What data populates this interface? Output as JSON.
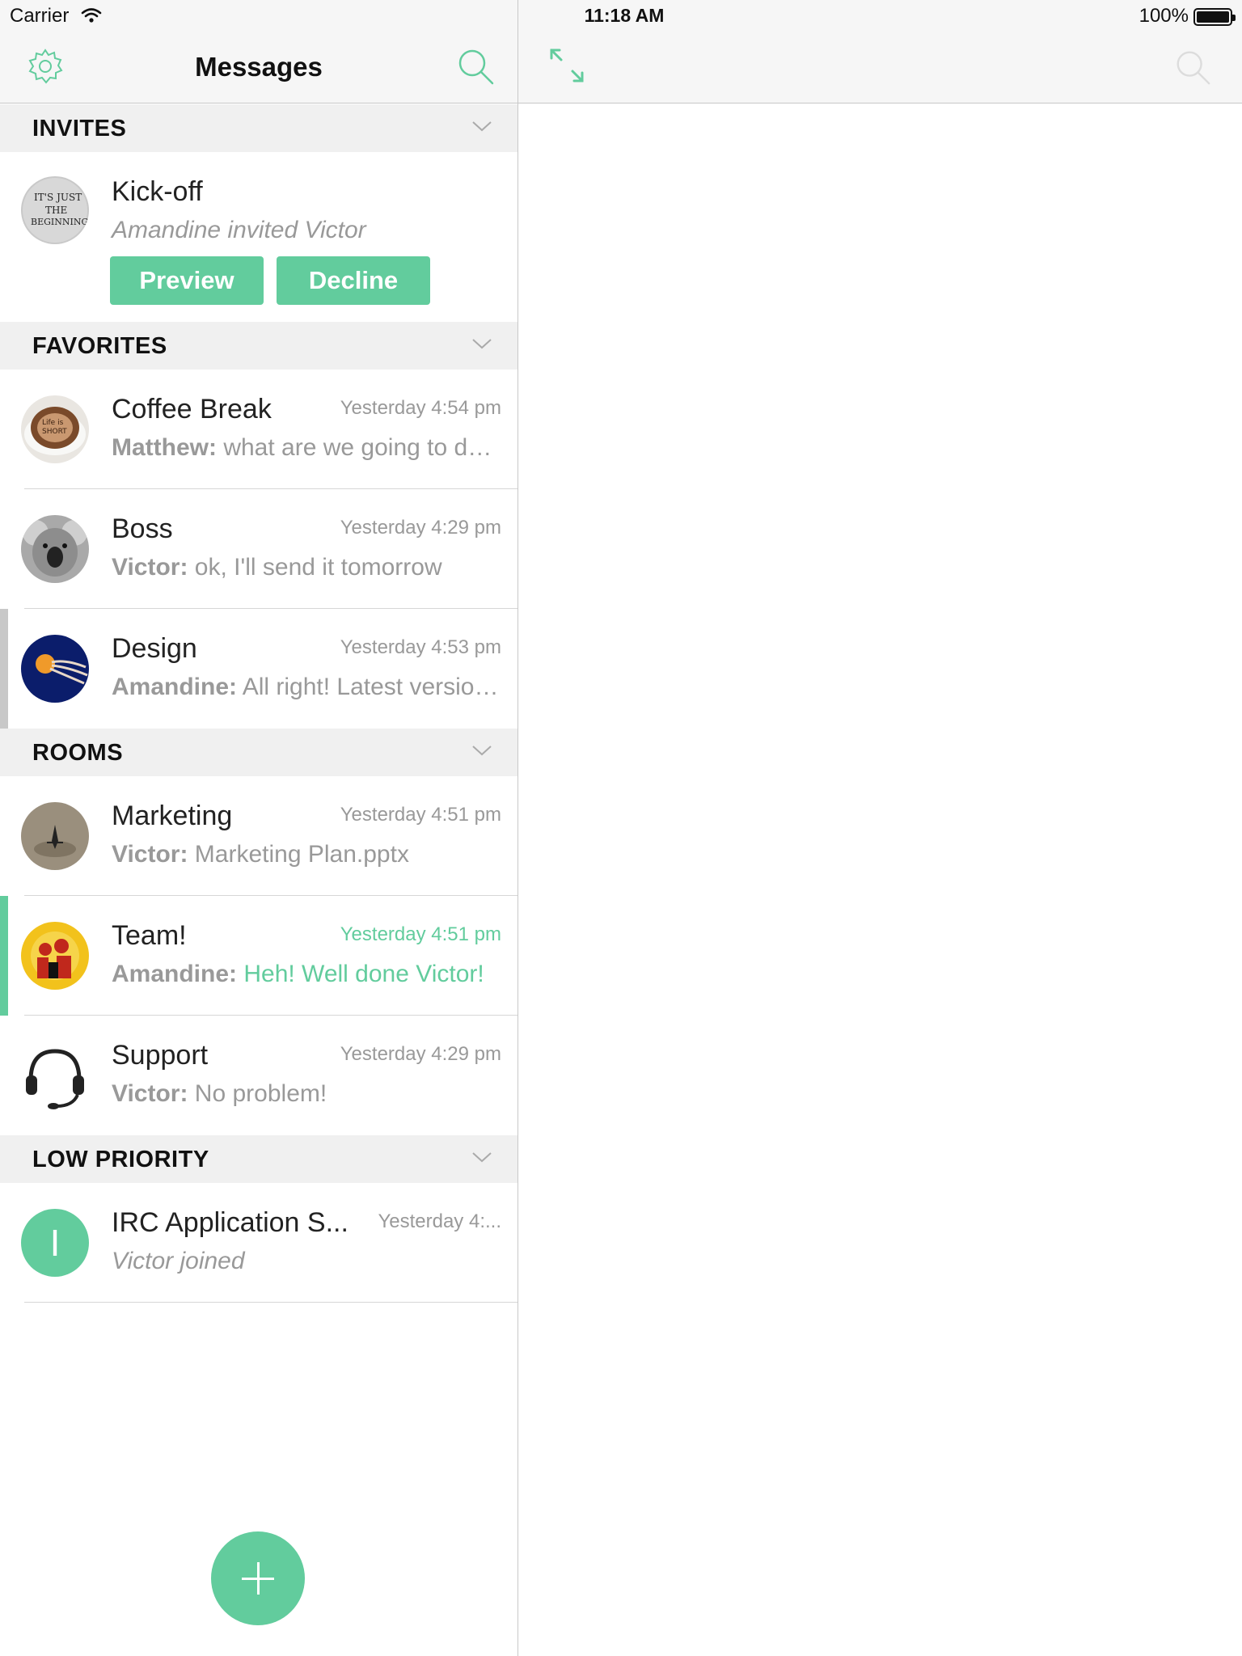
{
  "status_bar": {
    "carrier": "Carrier",
    "time": "11:18 AM",
    "battery": "100%"
  },
  "header": {
    "title": "Messages"
  },
  "colors": {
    "accent": "#62cc9d",
    "section_bg": "#f0f0f0",
    "muted_text": "#999999",
    "selected_marker": "#c8c8c8"
  },
  "sections": {
    "invites": "INVITES",
    "favorites": "FAVORITES",
    "rooms": "ROOMS",
    "low_priority": "LOW PRIORITY"
  },
  "invite": {
    "name": "Kick-off",
    "subtitle": "Amandine invited Victor",
    "preview_label": "Preview",
    "decline_label": "Decline"
  },
  "favorites": [
    {
      "name": "Coffee Break",
      "time": "Yesterday 4:54 pm",
      "sender": "Matthew:",
      "message": " what are we going to do today?"
    },
    {
      "name": "Boss",
      "time": "Yesterday 4:29 pm",
      "sender": "Victor:",
      "message": " ok, I'll send it tomorrow"
    },
    {
      "name": "Design",
      "time": "Yesterday 4:53 pm",
      "sender": "Amandine:",
      "message": " All right! Latest version attached"
    }
  ],
  "rooms": [
    {
      "name": "Marketing",
      "time": "Yesterday 4:51 pm",
      "sender": "Victor:",
      "message": " Marketing Plan.pptx"
    },
    {
      "name": "Team!",
      "time": "Yesterday 4:51 pm",
      "sender": "Amandine:",
      "message": " Heh! Well done Victor!"
    },
    {
      "name": "Support",
      "time": "Yesterday 4:29 pm",
      "sender": "Victor:",
      "message": " No problem!"
    }
  ],
  "low_priority": [
    {
      "name": "IRC Application S...",
      "time": "Yesterday 4:...",
      "subtitle": "Victor joined",
      "avatar_letter": "I"
    }
  ]
}
